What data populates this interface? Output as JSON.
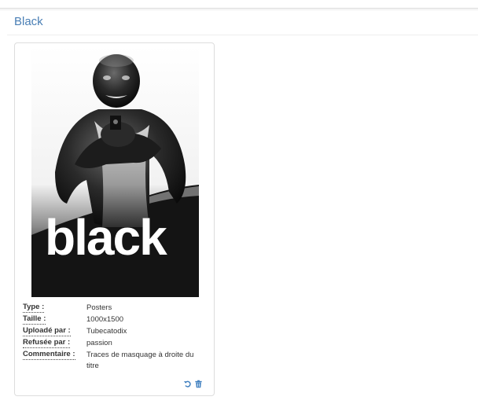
{
  "section": {
    "title": "Black"
  },
  "poster": {
    "word": "black"
  },
  "details": {
    "type_label": "Type :",
    "type_value": "Posters",
    "size_label": "Taille :",
    "size_value": "1000x1500",
    "uploader_label": "Uploadé par :",
    "uploader_value": "Tubecatodix",
    "refused_label": "Refusée par :",
    "refused_value": "passion",
    "comment_label": "Commentaire :",
    "comment_value": "Traces de masquage à droite du titre"
  },
  "actions": {
    "restore_icon": "undo-icon",
    "delete_icon": "trash-icon",
    "accent_color": "#3f7fbf"
  }
}
